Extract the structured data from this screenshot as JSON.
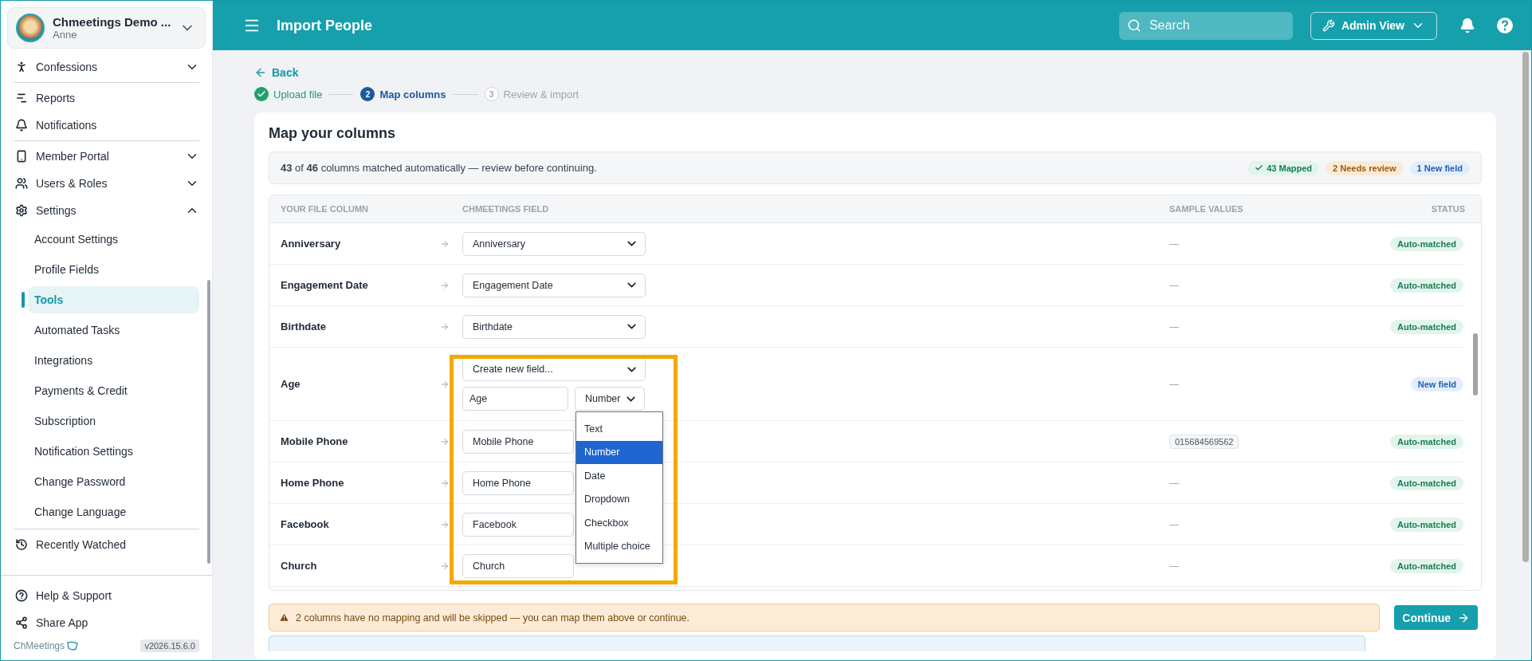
{
  "account": {
    "name": "Chmeetings Demo ...",
    "user": "Anne"
  },
  "sidebar": {
    "groups": [
      [
        {
          "label": "Confessions",
          "expanded": false
        }
      ],
      [
        {
          "label": "Reports"
        },
        {
          "label": "Notifications"
        }
      ],
      [
        {
          "label": "Member Portal",
          "expanded": false
        },
        {
          "label": "Users & Roles",
          "expanded": false
        },
        {
          "label": "Settings",
          "expanded": true,
          "children": [
            {
              "label": "Account Settings",
              "selected": false
            },
            {
              "label": "Profile Fields",
              "selected": false
            },
            {
              "label": "Tools",
              "selected": true
            },
            {
              "label": "Automated Tasks",
              "selected": false
            },
            {
              "label": "Integrations",
              "selected": false
            },
            {
              "label": "Payments & Credit",
              "selected": false
            },
            {
              "label": "Subscription",
              "selected": false
            },
            {
              "label": "Notification Settings",
              "selected": false
            },
            {
              "label": "Change Password",
              "selected": false
            },
            {
              "label": "Change Language",
              "selected": false
            }
          ]
        }
      ],
      [
        {
          "label": "Recently Watched"
        }
      ]
    ],
    "footer_items": [
      {
        "label": "Help & Support"
      },
      {
        "label": "Share App"
      }
    ],
    "brand": "ChMeetings",
    "version": "v2026.15.6.0"
  },
  "topbar": {
    "title": "Import People",
    "search": {
      "placeholder": "Search"
    },
    "view_button": "Admin View"
  },
  "back": "Back",
  "steps": [
    {
      "label": "Upload file",
      "completed": true,
      "selected": false
    },
    {
      "number": "2",
      "label": "Map columns",
      "completed": false,
      "selected": true
    },
    {
      "number": "3",
      "label": "Review & import",
      "completed": false,
      "selected": false
    }
  ],
  "card": {
    "title": "Map your columns",
    "summary": "**43** of **46** columns matched automatically — review before continuing.",
    "badges": [
      {
        "kind": "mapped",
        "label": "43 Mapped"
      },
      {
        "kind": "review",
        "label": "2 Needs review"
      },
      {
        "kind": "new",
        "label": "1 New field"
      }
    ],
    "columns": [
      "YOUR FILE COLUMN",
      "CHMEETINGS FIELD",
      "SAMPLE VALUES",
      "STATUS"
    ],
    "rows": [
      {
        "column": "Anniversary",
        "field": "Anniversary",
        "sample": {
          "kind": "dash",
          "text": "—"
        },
        "status": {
          "kind": "auto",
          "label": "Auto-matched"
        }
      },
      {
        "column": "Engagement Date",
        "field": "Engagement Date",
        "sample": {
          "kind": "dash",
          "text": "—"
        },
        "status": {
          "kind": "auto",
          "label": "Auto-matched"
        }
      },
      {
        "column": "Birthdate",
        "field": "Birthdate",
        "sample": {
          "kind": "dash",
          "text": "—"
        },
        "status": {
          "kind": "auto",
          "label": "Auto-matched"
        }
      },
      {
        "column": "Age",
        "kind": "new",
        "highlight": true,
        "field": "Create new field...",
        "new_name": "Age",
        "new_type": {
          "value": "Number",
          "open": true,
          "options": [
            {
              "label": "Text",
              "selected": false
            },
            {
              "label": "Number",
              "selected": true
            },
            {
              "label": "Date",
              "selected": false
            },
            {
              "label": "Dropdown",
              "selected": false
            },
            {
              "label": "Checkbox",
              "selected": false
            },
            {
              "label": "Multiple choice",
              "selected": false
            }
          ]
        },
        "sample": {
          "kind": "dash",
          "text": "—"
        },
        "status": {
          "kind": "new",
          "label": "New field"
        }
      },
      {
        "column": "Mobile Phone",
        "field": "Mobile Phone",
        "covered": true,
        "sample": {
          "kind": "chip",
          "text": "015684569562"
        },
        "status": {
          "kind": "auto",
          "label": "Auto-matched"
        }
      },
      {
        "column": "Home Phone",
        "field": "Home Phone",
        "covered": true,
        "sample": {
          "kind": "dash",
          "text": "—"
        },
        "status": {
          "kind": "auto",
          "label": "Auto-matched"
        }
      },
      {
        "column": "Facebook",
        "field": "Facebook",
        "covered": true,
        "sample": {
          "kind": "dash",
          "text": "—"
        },
        "status": {
          "kind": "auto",
          "label": "Auto-matched"
        }
      },
      {
        "column": "Church",
        "field": "Church",
        "covered": true,
        "sample": {
          "kind": "dash",
          "text": "—"
        },
        "status": {
          "kind": "auto",
          "label": "Auto-matched"
        }
      }
    ],
    "warning": "2 columns have no mapping and will be skipped — you can map them above or continue.",
    "continue": "Continue"
  }
}
